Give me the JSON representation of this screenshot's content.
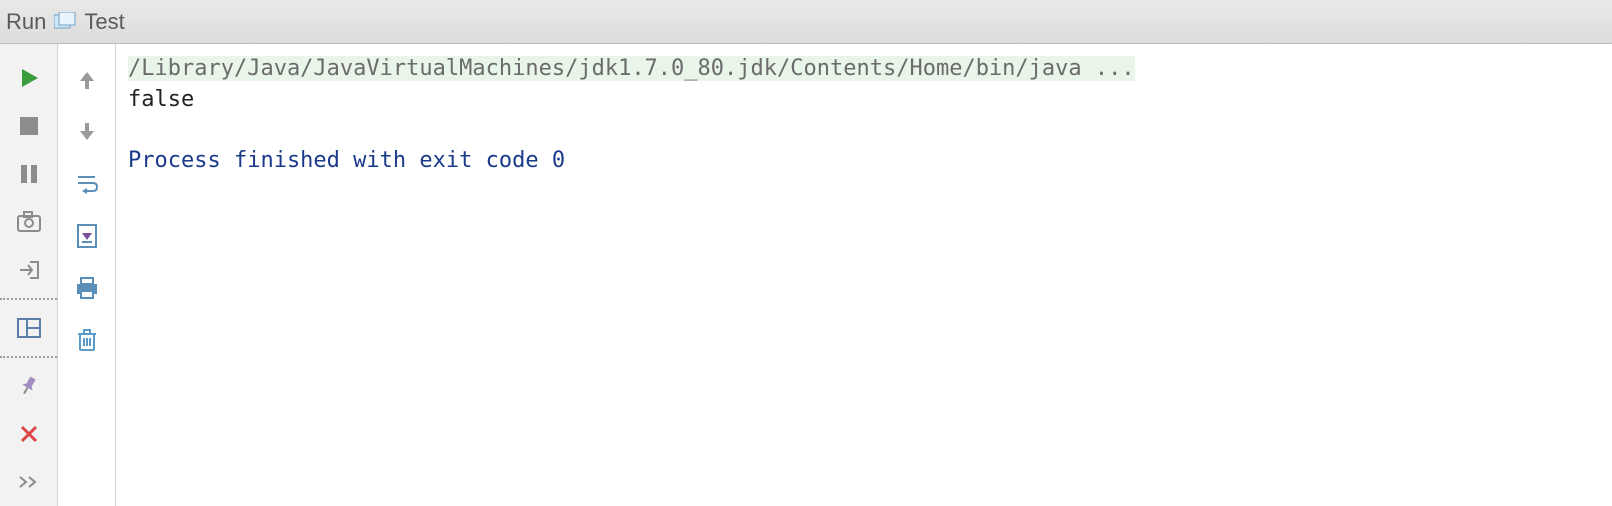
{
  "header": {
    "tool_window": "Run",
    "config_name": "Test"
  },
  "console": {
    "command": "/Library/Java/JavaVirtualMachines/jdk1.7.0_80.jdk/Contents/Home/bin/java ...",
    "output": "false",
    "exit_message": "Process finished with exit code 0"
  },
  "icons": {
    "run": "run",
    "stop": "stop",
    "pause": "pause",
    "dump": "dump",
    "exit": "exit",
    "layout": "layout",
    "pin": "pin",
    "close": "close",
    "more": "more",
    "up": "up",
    "down": "down",
    "wrap": "soft-wrap",
    "scroll": "scroll-to-end",
    "print": "print",
    "clear": "clear"
  }
}
